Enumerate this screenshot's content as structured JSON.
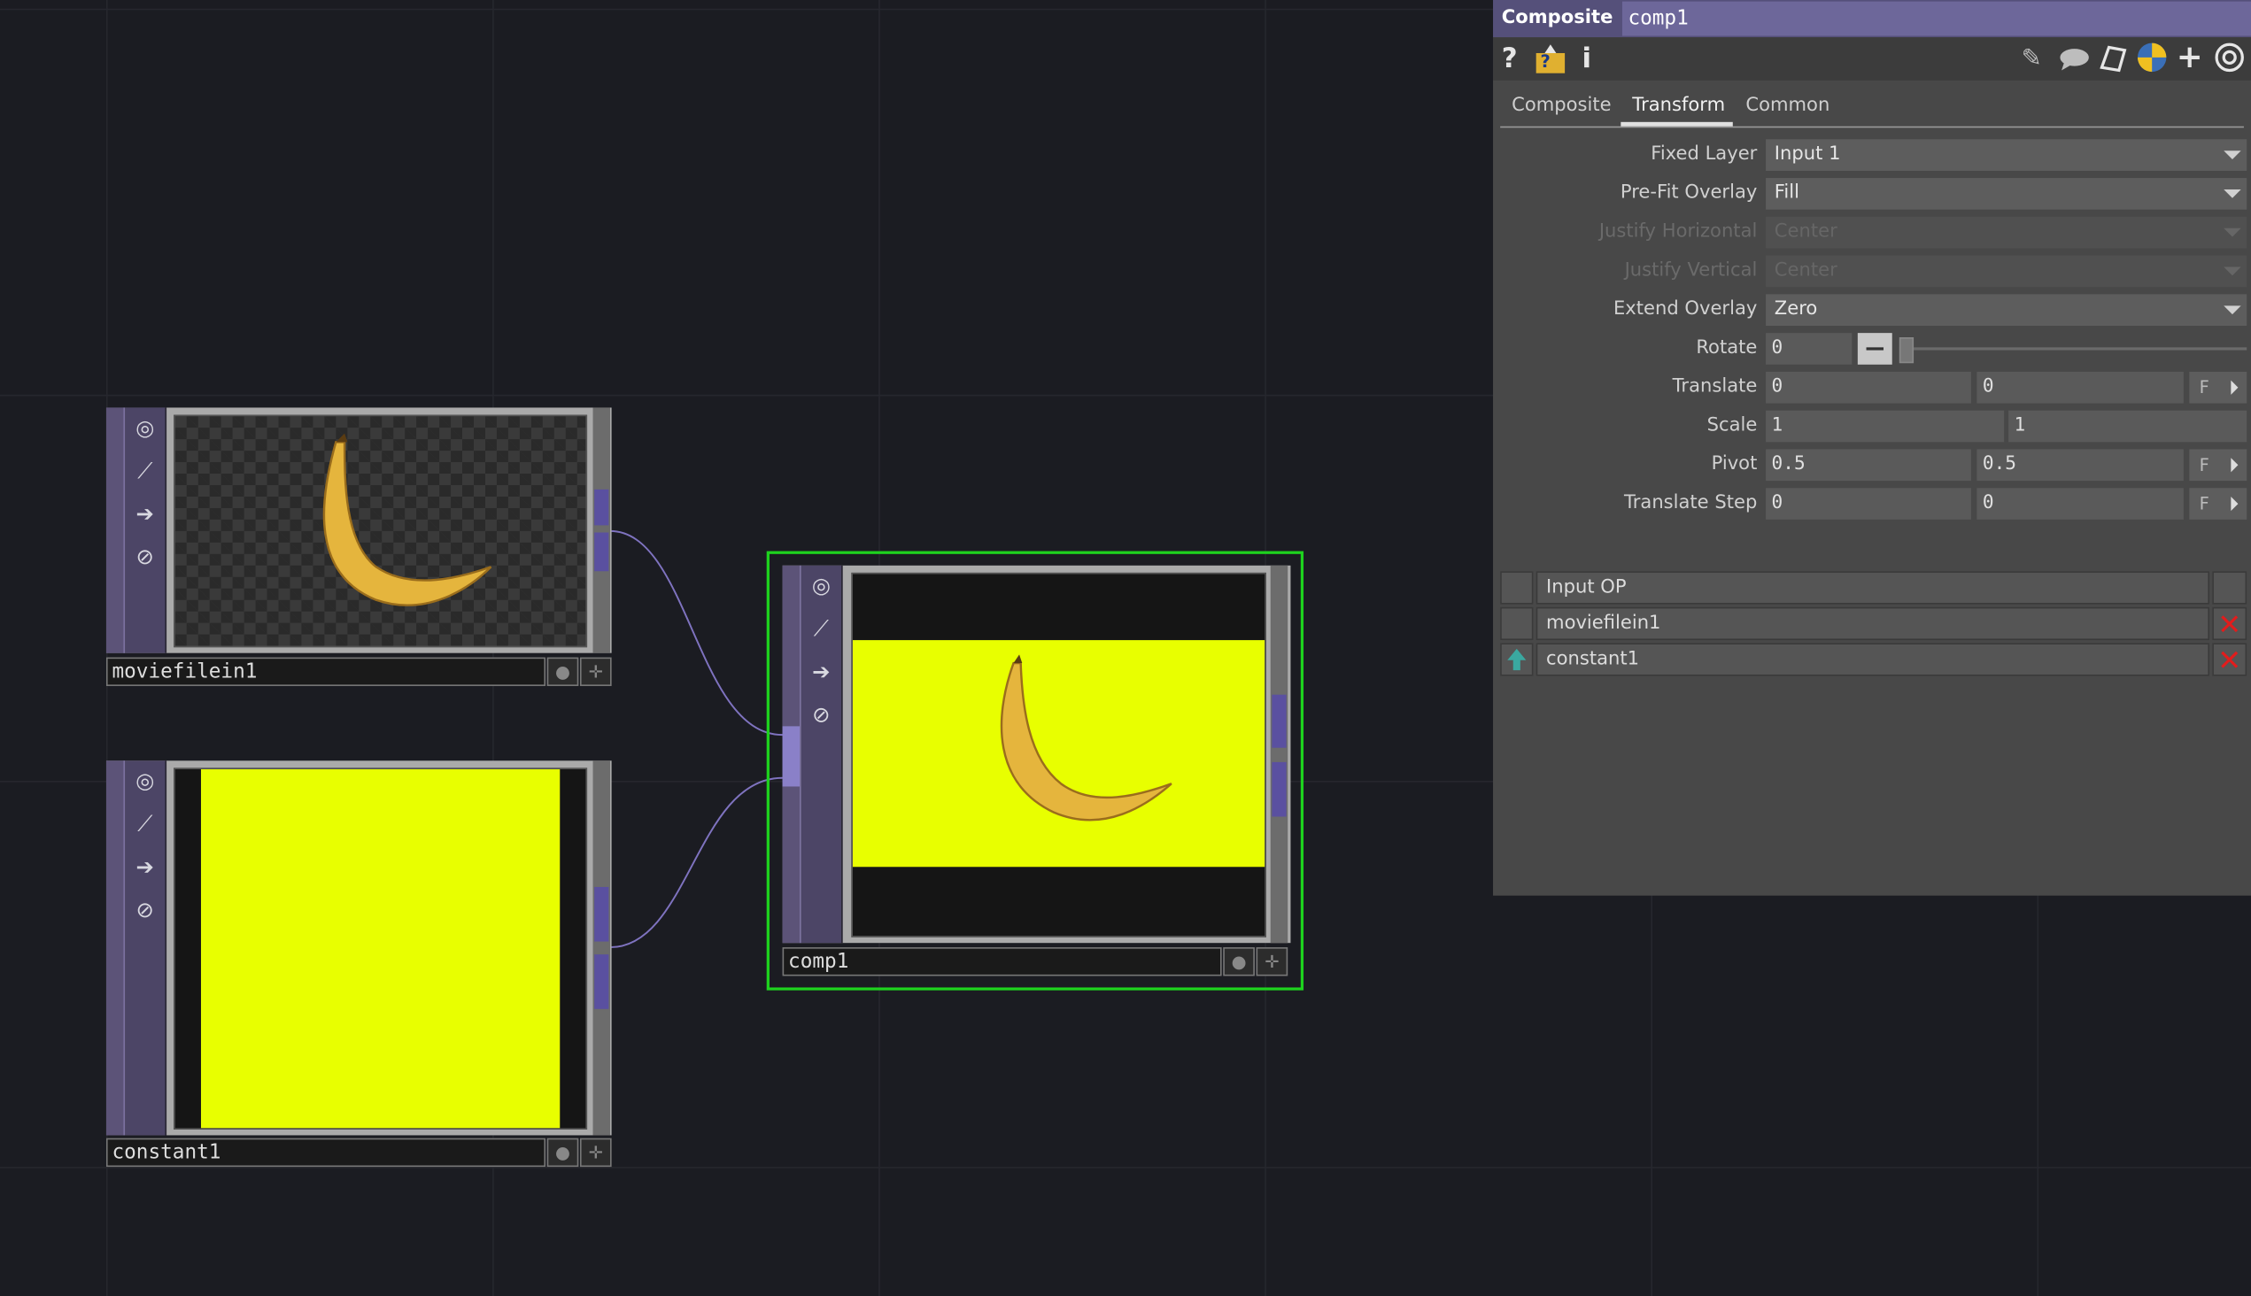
{
  "nodes": {
    "moviefilein1": {
      "name": "moviefilein1"
    },
    "constant1": {
      "name": "constant1",
      "color": "#e8ff00"
    },
    "comp1": {
      "name": "comp1",
      "selected_color": "#1ed21e"
    }
  },
  "panel": {
    "op_type": "Composite",
    "op_name": "comp1",
    "tools": {
      "help": "?",
      "info": "i",
      "add": "+"
    },
    "tabs": [
      "Composite",
      "Transform",
      "Common"
    ],
    "active_tab": "Transform",
    "params": {
      "fixed_layer": {
        "label": "Fixed Layer",
        "value": "Input 1"
      },
      "prefit_overlay": {
        "label": "Pre-Fit Overlay",
        "value": "Fill"
      },
      "justify_h": {
        "label": "Justify Horizontal",
        "value": "Center"
      },
      "justify_v": {
        "label": "Justify Vertical",
        "value": "Center"
      },
      "extend_overlay": {
        "label": "Extend Overlay",
        "value": "Zero"
      },
      "rotate": {
        "label": "Rotate",
        "value": "0"
      },
      "translate": {
        "label": "Translate",
        "x": "0",
        "y": "0",
        "btn": "F"
      },
      "scale": {
        "label": "Scale",
        "x": "1",
        "y": "1"
      },
      "pivot": {
        "label": "Pivot",
        "x": "0.5",
        "y": "0.5",
        "btn": "F"
      },
      "translate_step": {
        "label": "Translate Step",
        "x": "0",
        "y": "0",
        "btn": "F"
      }
    },
    "input_table": {
      "header": "Input OP",
      "rows": [
        "moviefilein1",
        "constant1"
      ],
      "remove_glyph": "✕"
    }
  }
}
